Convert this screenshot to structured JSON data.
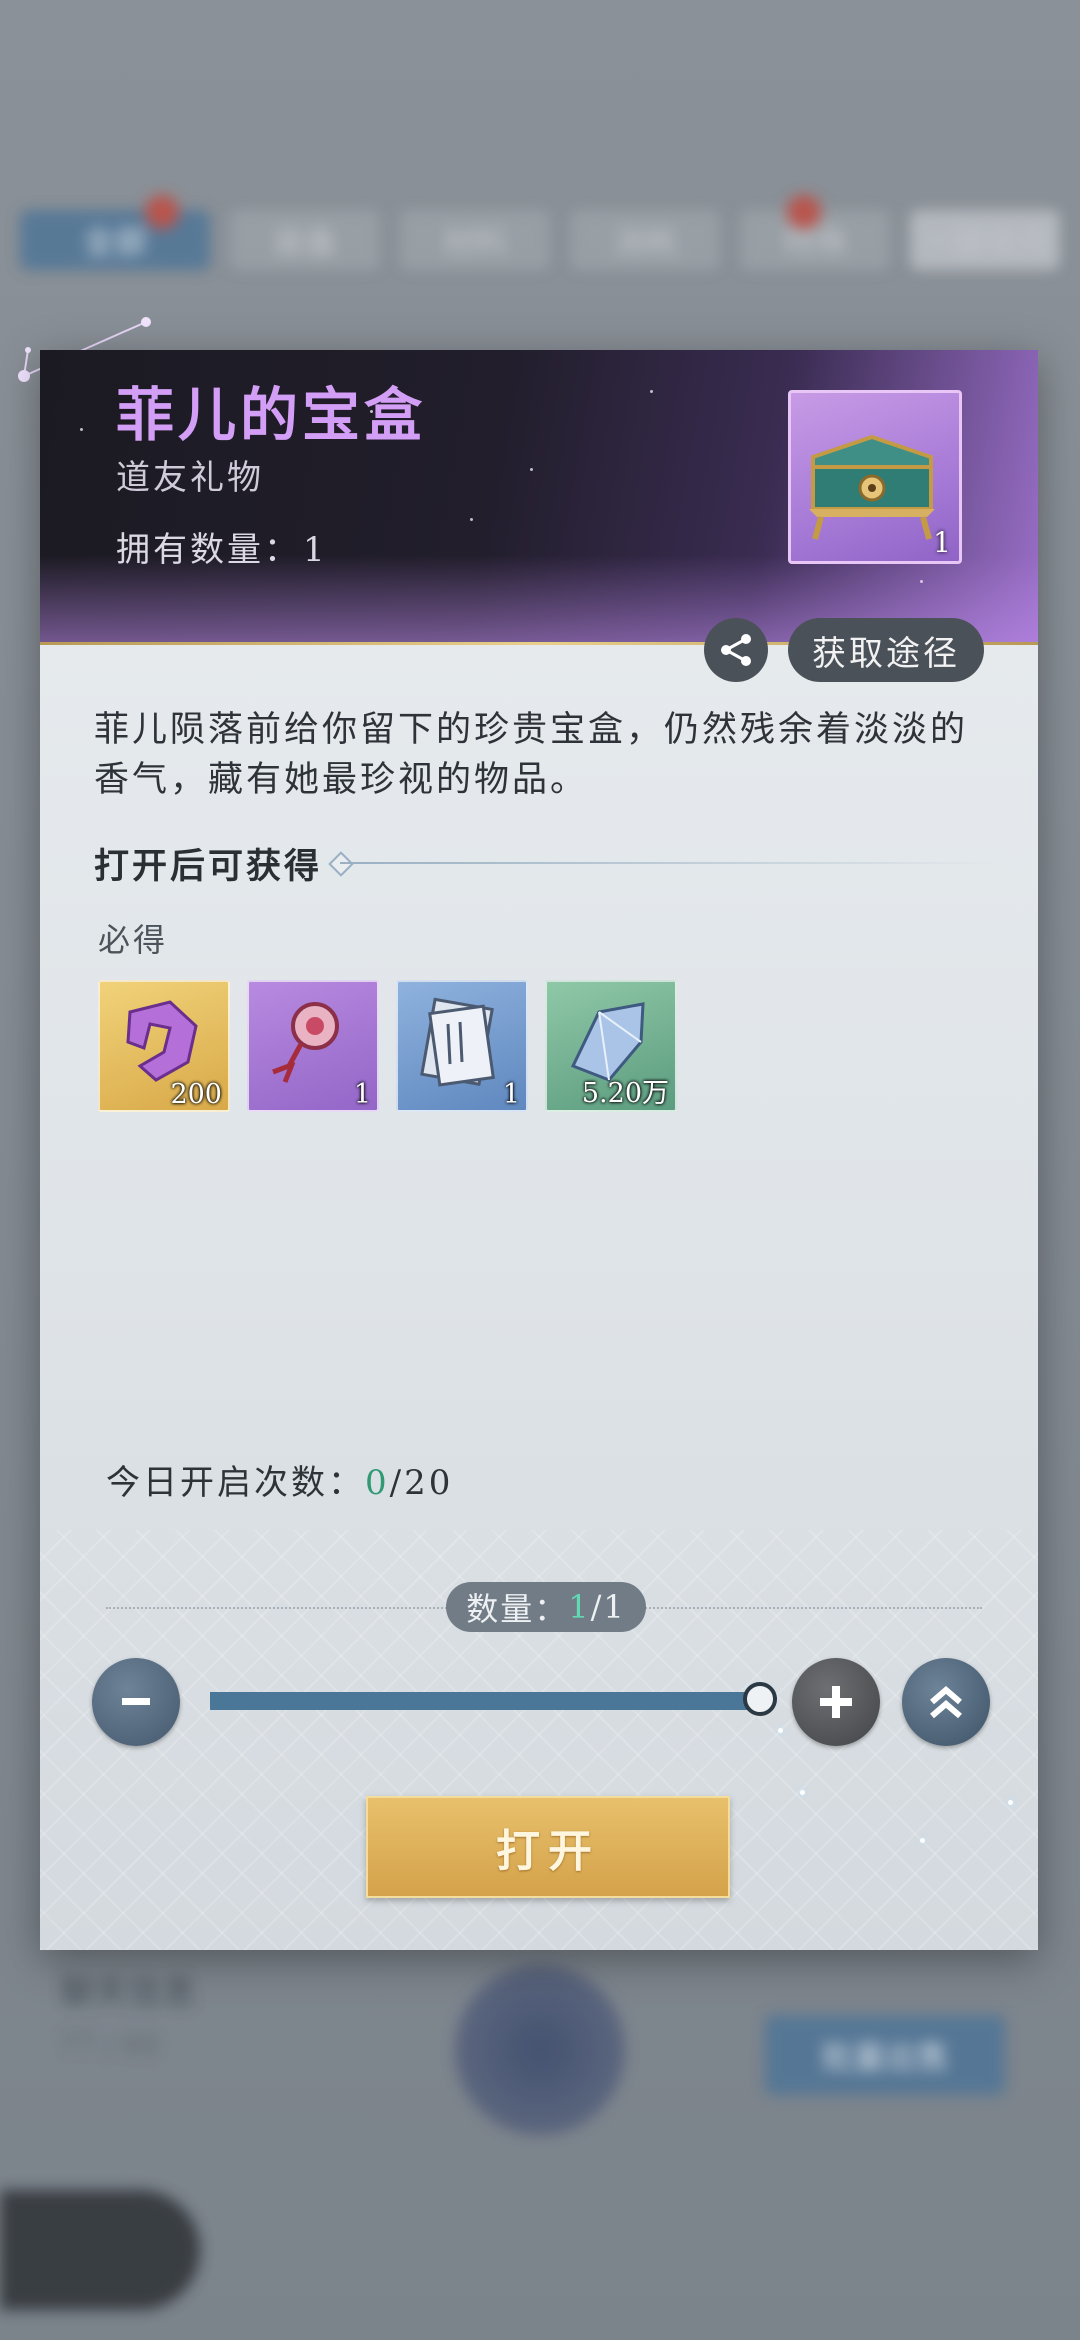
{
  "background": {
    "tabs": [
      "全部",
      "装备",
      "材料",
      "消耗",
      "特殊",
      "一键使用"
    ],
    "bottom_name": "聊天信息",
    "bottom_sub": "77 / 60",
    "bottom_button": "批量出售"
  },
  "item": {
    "title": "菲儿的宝盒",
    "type": "道友礼物",
    "owned_label": "拥有数量：",
    "owned_value": "1",
    "icon_count": "1",
    "icon": "treasure-chest-icon"
  },
  "actions": {
    "source_label": "获取途径",
    "share_icon": "share-icon"
  },
  "description": "菲儿陨落前给你留下的珍贵宝盒，仍然残余着淡淡的香气，藏有她最珍视的物品。",
  "rewards_section": {
    "title": "打开后可获得",
    "must_label": "必得",
    "items": [
      {
        "icon": "purple-jade-icon",
        "count": "200",
        "rarity": "gold"
      },
      {
        "icon": "pendant-icon",
        "count": "1",
        "rarity": "purple"
      },
      {
        "icon": "scroll-pages-icon",
        "count": "1",
        "rarity": "blue"
      },
      {
        "icon": "crystal-icon",
        "count": "5.20万",
        "rarity": "green"
      }
    ]
  },
  "daily": {
    "label": "今日开启次数：",
    "current": "0",
    "max": "/20"
  },
  "quantity": {
    "label": "数量：",
    "current": "1",
    "max": "/1",
    "slider_fraction": 1.0
  },
  "open_button": "打开",
  "colors": {
    "title": "#d39ef5",
    "highlight_green": "#2f9a73",
    "button_gold": "#d4a24a",
    "slider": "#4a7698"
  }
}
